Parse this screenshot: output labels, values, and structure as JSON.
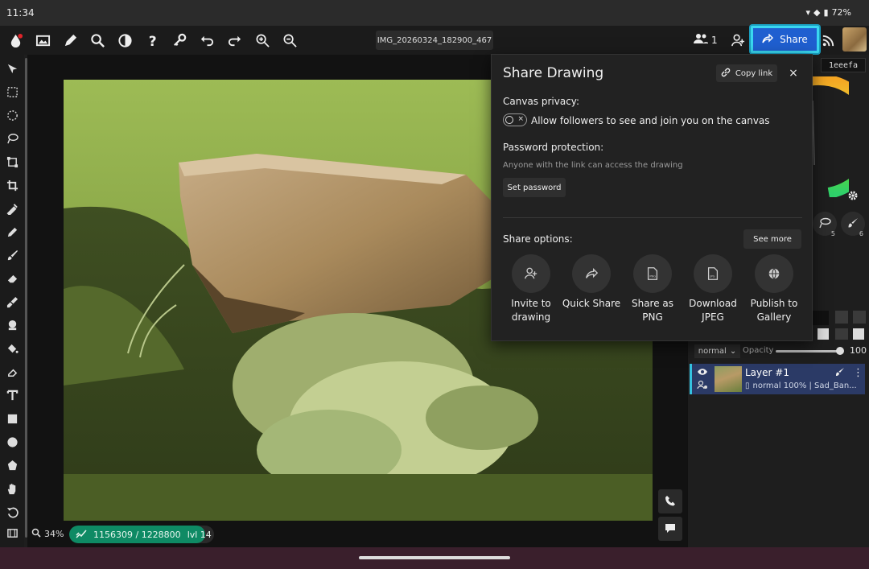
{
  "status_bar": {
    "time": "11:34",
    "battery": "72%"
  },
  "toolbar": {
    "filename": "IMG_20260324_182900_467",
    "users_count": "1",
    "share_label": "Share"
  },
  "color_panel": {
    "hex": "1eeefa",
    "brush_slot_5": "5",
    "brush_slot_6": "6"
  },
  "layers": {
    "blend_mode": "normal",
    "opacity_label": "Opacity",
    "opacity_value": "100",
    "layer_name": "Layer #1",
    "layer_meta": "normal 100% | Sad_Ban..."
  },
  "canvas": {
    "zoom": "34%",
    "progress_text": "1156309 / 1228800",
    "level": "lvl 14",
    "progress_fraction": 0.941
  },
  "share_dialog": {
    "title": "Share Drawing",
    "copy_link": "Copy link",
    "close": "×",
    "canvas_privacy_label": "Canvas privacy:",
    "privacy_toggle_text": "Allow followers to see and join you on the canvas",
    "password_label": "Password protection:",
    "password_hint": "Anyone with the link can access the drawing",
    "set_password": "Set password",
    "share_options_label": "Share options:",
    "see_more": "See more",
    "options": [
      {
        "line1": "Invite to",
        "line2": "drawing",
        "icon": "add-user-icon"
      },
      {
        "line1": "Quick Share",
        "line2": "",
        "icon": "share-arrow-icon"
      },
      {
        "line1": "Share as",
        "line2": "PNG",
        "icon": "png-file-icon"
      },
      {
        "line1": "Download",
        "line2": "JPEG",
        "icon": "jpeg-file-icon"
      },
      {
        "line1": "Publish to",
        "line2": "Gallery",
        "icon": "globe-icon"
      }
    ]
  },
  "colors": {
    "accent": "#1f5fd0",
    "highlight": "#3ad7f0",
    "progress": "#0e8a64",
    "layer_selected": "#2b3a66"
  }
}
